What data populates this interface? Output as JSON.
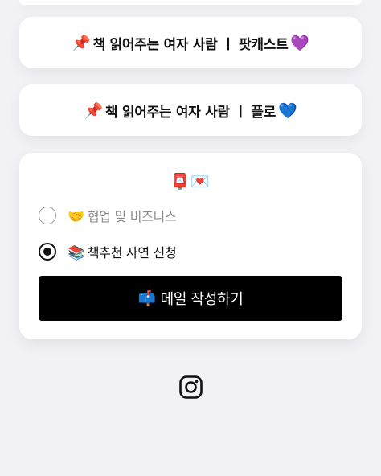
{
  "links": [
    {
      "emoji": "📌",
      "label": "책 읽어주는 여자 사람 ㅣ 팟캐스트",
      "trail_emoji": "💜"
    },
    {
      "emoji": "📌",
      "label": "책 읽어주는 여자 사람 ㅣ 플로",
      "trail_emoji": "💙"
    }
  ],
  "form": {
    "header_icons": "📮💌",
    "options": [
      {
        "emoji": "🤝",
        "label": "협업 및 비즈니스",
        "selected": false
      },
      {
        "emoji": "📚",
        "label": "책추천 사연 신청",
        "selected": true
      }
    ],
    "submit": {
      "emoji": "📫",
      "label": "메일 작성하기"
    }
  },
  "footer": {
    "icon": "instagram-icon"
  }
}
